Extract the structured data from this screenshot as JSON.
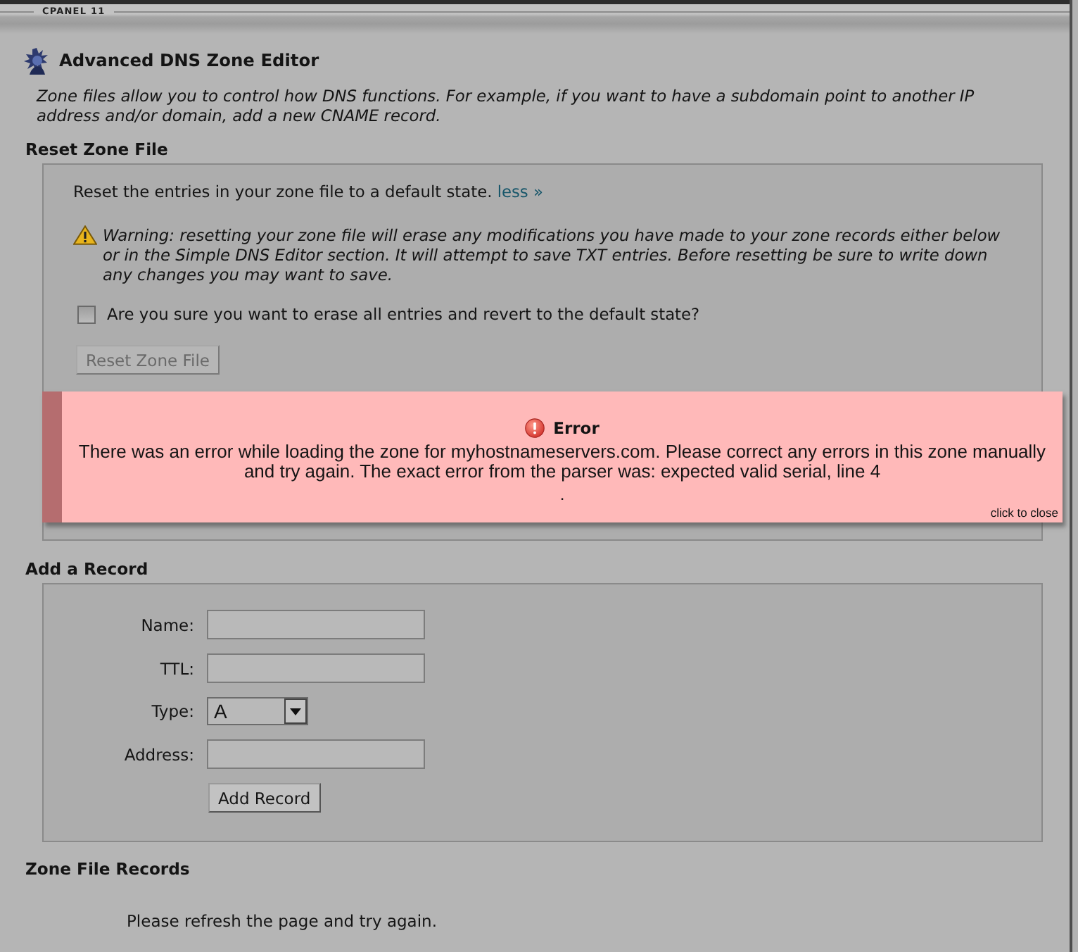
{
  "header": {
    "brand": "CPANEL 11"
  },
  "page": {
    "title": "Advanced DNS Zone Editor",
    "description": "Zone files allow you to control how DNS functions. For example, if you want to have a subdomain point to another IP address and/or domain, add a new CNAME record."
  },
  "reset_section": {
    "heading": "Reset Zone File",
    "intro": "Reset the entries in your zone file to a default state.",
    "link": "less »",
    "warning": "Warning: resetting your zone file will erase any modifications you have made to your zone records either below or in the Simple DNS Editor section. It will attempt to save TXT entries. Before resetting be sure to write down any changes you may want to save.",
    "confirm": {
      "label": "Are you sure you want to erase all entries and revert to the default state?",
      "checked": false
    },
    "button": {
      "label": "Reset Zone File",
      "disabled": true
    }
  },
  "error_popup": {
    "title": "Error",
    "message": "There was an error while loading the zone for myhostnameservers.com. Please correct any errors in this zone manually and try again. The exact error from the parser was: expected valid serial, line 4",
    "detail": ".",
    "close_hint": "click to close"
  },
  "add_section": {
    "heading": "Add a Record",
    "fields": [
      {
        "kind": "text",
        "label": "Name:"
      },
      {
        "kind": "text",
        "label": "TTL:"
      },
      {
        "kind": "select",
        "label": "Type:",
        "value": "A"
      },
      {
        "kind": "text",
        "label": "Address:"
      }
    ],
    "button": "Add Record"
  },
  "records_section": {
    "heading": "Zone File Records",
    "message": "Please refresh the page and try again."
  }
}
